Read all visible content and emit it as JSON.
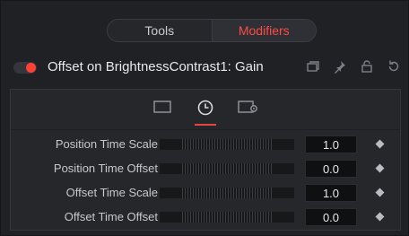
{
  "tabs": {
    "tools": "Tools",
    "modifiers": "Modifiers"
  },
  "header": {
    "title": "Offset on BrightnessContrast1: Gain",
    "toggle_color": "#ff4035"
  },
  "header_icons": [
    "copy-icon",
    "pin-icon",
    "lock-icon",
    "reset-icon"
  ],
  "sub_tabs": [
    "frame-icon",
    "clock-icon",
    "settings-icon"
  ],
  "rows": [
    {
      "label": "Position Time Scale",
      "value": "1.0"
    },
    {
      "label": "Position Time Offset",
      "value": "0.0"
    },
    {
      "label": "Offset Time Scale",
      "value": "1.0"
    },
    {
      "label": "Offset Time Offset",
      "value": "0.0"
    }
  ],
  "colors": {
    "accent": "#ff4a45",
    "background": "#202124"
  }
}
